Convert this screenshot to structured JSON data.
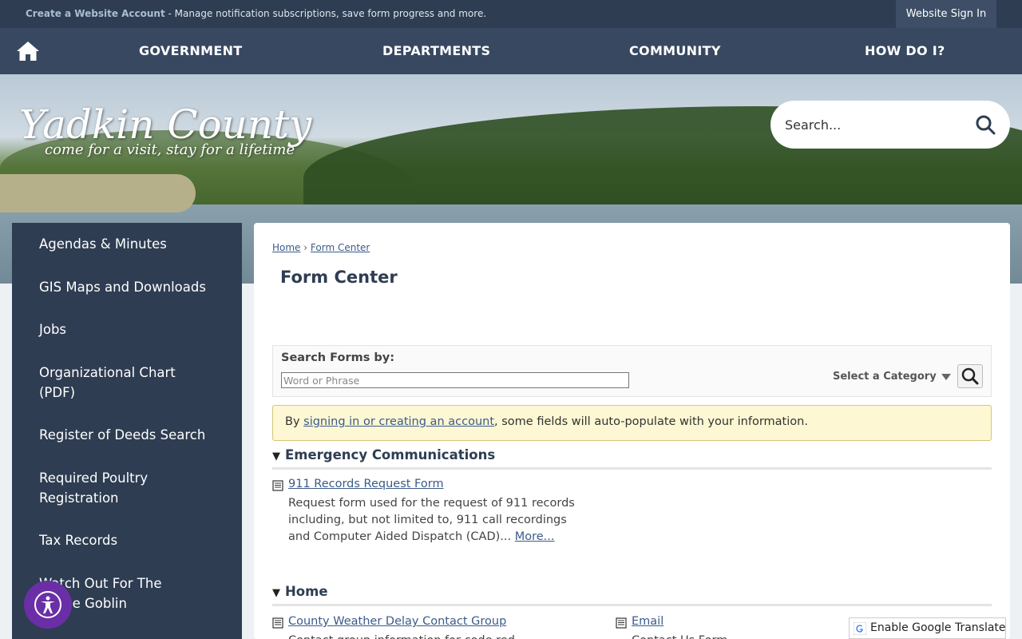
{
  "topbar": {
    "create_link": "Create a Website Account",
    "message": " - Manage notification subscriptions, save form progress and more.",
    "signin": "Website Sign In"
  },
  "nav": {
    "items": [
      "GOVERNMENT",
      "DEPARTMENTS",
      "COMMUNITY",
      "HOW DO I?"
    ]
  },
  "banner": {
    "logo_name": "Yadkin County",
    "logo_tagline": "come for a visit, stay for a lifetime"
  },
  "search": {
    "placeholder": "Search..."
  },
  "sidebar": {
    "items": [
      "Agendas & Minutes",
      "GIS Maps and Downloads",
      "Jobs",
      "Organizational Chart (PDF)",
      "Register of Deeds Search",
      "Required Poultry Registration",
      "Tax Records",
      "Watch Out For The Goose Goblin"
    ]
  },
  "main": {
    "breadcrumb": {
      "home": "Home",
      "sep": "›",
      "current": "Form Center"
    },
    "title": "Form Center",
    "search_forms": {
      "label": "Search Forms by:",
      "placeholder": "Word or Phrase",
      "category": "Select a Category"
    },
    "notice": {
      "prefix": "By ",
      "link": "signing in or creating an account",
      "suffix": ", some fields will auto-populate with your information."
    },
    "categories": [
      {
        "name": "Emergency Communications",
        "forms": [
          {
            "title": "911 Records Request Form",
            "description": "Request form used for the request of 911 records including, but not limited to, 911 call recordings and Computer Aided Dispatch (CAD)...",
            "more": "More..."
          }
        ]
      },
      {
        "name": "Home",
        "forms": [
          {
            "title": "County Weather Delay Contact Group",
            "description": "Contact group information for code red"
          },
          {
            "title": "Email",
            "description": "Contact Us Form"
          }
        ]
      }
    ]
  },
  "translate": "Enable Google Translate",
  "colors": {
    "navy": "#2e3d52",
    "link": "#3b5b8a",
    "notice_bg": "#fdf7d3",
    "a11y": "#6a2fa6"
  }
}
